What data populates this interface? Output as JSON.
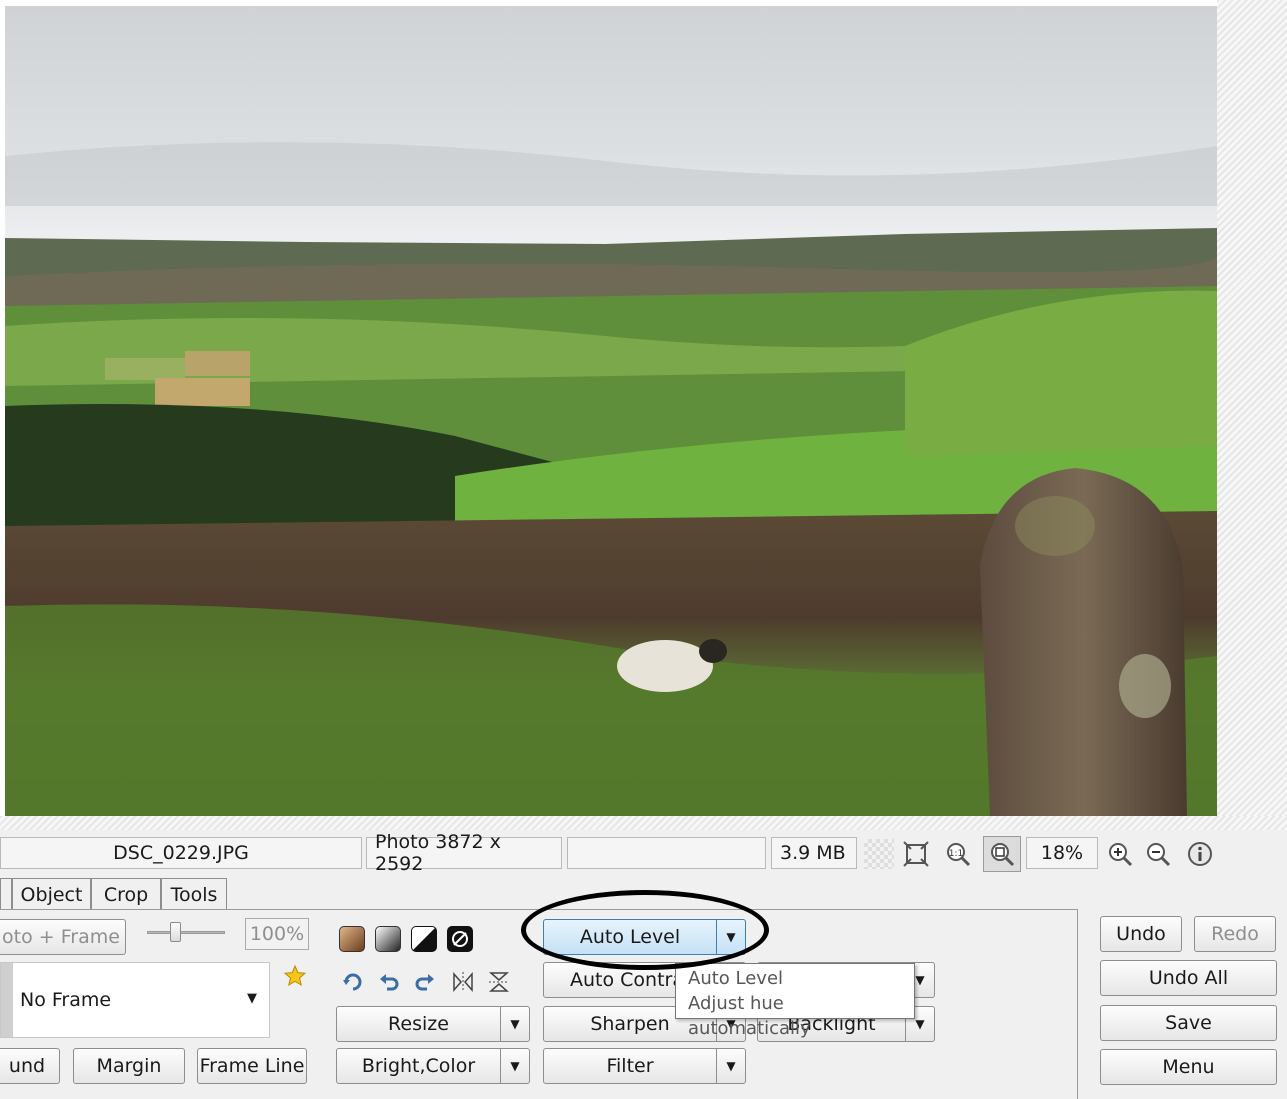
{
  "status": {
    "filename": "DSC_0229.JPG",
    "dimensions": "Photo 3872 x 2592",
    "extra": "",
    "filesize": "3.9 MB",
    "zoom": "18%"
  },
  "tabs": [
    "Object",
    "Crop",
    "Tools"
  ],
  "frame": {
    "photo_frame_label": "oto + Frame",
    "opacity_value": "100%",
    "frame_select_value": "No Frame",
    "background_label": "und",
    "margin_label": "Margin",
    "frame_line_label": "Frame Line"
  },
  "adjust": {
    "auto_level": "Auto Level",
    "auto_contrast": "Auto Contrast",
    "backlight": "Backlight",
    "resize": "Resize",
    "sharpen": "Sharpen",
    "bright_color": "Bright,Color",
    "filter": "Filter"
  },
  "tooltip": {
    "title": "Auto Level",
    "description": "Adjust hue automatically"
  },
  "history": {
    "undo": "Undo",
    "redo": "Redo",
    "undo_all": "Undo All",
    "save": "Save",
    "menu": "Menu"
  },
  "icons": {
    "fit": "fit-window-icon",
    "actual": "actual-size-icon",
    "zoom_fit": "zoom-fit-icon",
    "zoom_in": "zoom-in-icon",
    "zoom_out": "zoom-out-icon",
    "info": "info-icon",
    "favorite": "star-icon",
    "sepia": "sepia-icon",
    "grayscale": "grayscale-icon",
    "contrast": "contrast-icon",
    "negative": "negative-icon",
    "rotate": "rotate-icon",
    "rotate_left": "rotate-left-icon",
    "rotate_right": "rotate-right-icon",
    "flip_h": "flip-horizontal-icon",
    "flip_v": "flip-vertical-icon"
  },
  "colors": {
    "highlight_button": "#c4e1f6",
    "annotation": "#000000"
  }
}
